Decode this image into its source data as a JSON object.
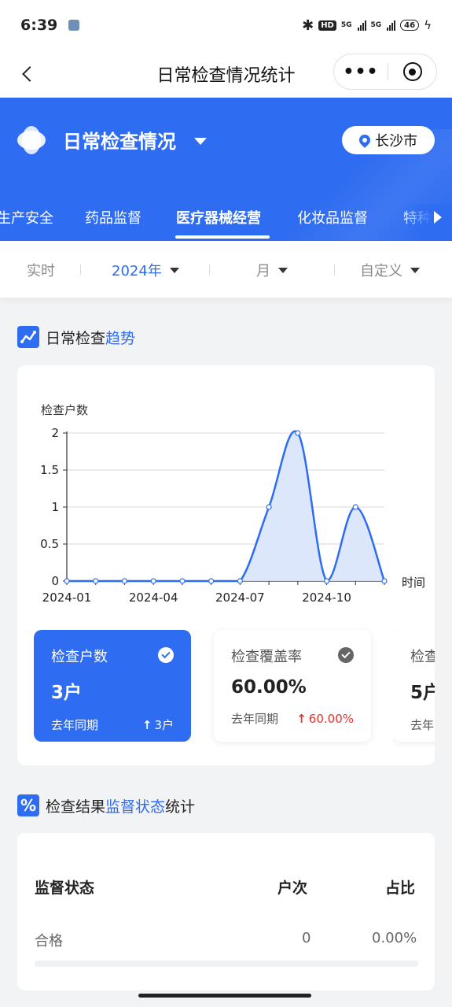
{
  "status_bar": {
    "time": "6:39",
    "hd": "HD",
    "sig1": "5G",
    "sig2": "5G",
    "battery": "46"
  },
  "nav": {
    "title": "日常检查情况统计",
    "more": "•••"
  },
  "header": {
    "title": "日常检查情况",
    "city": "长沙市",
    "tabs": [
      "生产安全",
      "药品监督",
      "医疗器械经营",
      "化妆品监督",
      "特种"
    ],
    "active_tab": "医疗器械经营"
  },
  "filters": {
    "realtime": "实时",
    "year": "2024年",
    "month": "月",
    "custom": "自定义"
  },
  "trend_section": {
    "title_prefix": "日常检查",
    "title_highlight": "趋势"
  },
  "chart_data": {
    "type": "area",
    "ylabel": "检查户数",
    "xlabel": "时间",
    "x": [
      "2024-01",
      "2024-02",
      "2024-03",
      "2024-04",
      "2024-05",
      "2024-06",
      "2024-07",
      "2024-08",
      "2024-09",
      "2024-10",
      "2024-11",
      "2024-12"
    ],
    "xtick_labels": [
      "2024-01",
      "2024-04",
      "2024-07",
      "2024-10"
    ],
    "values": [
      0,
      0,
      0,
      0,
      0,
      0,
      0,
      1,
      2,
      0,
      1,
      0
    ],
    "yticks": [
      "0",
      "0.5",
      "1",
      "1.5",
      "2"
    ],
    "ylim": [
      0,
      2
    ],
    "grid": true,
    "colors": {
      "line": "#2e6cf1",
      "fill": "#d8e4fb"
    }
  },
  "stat_cards": [
    {
      "title": "检查户数",
      "value": "3户",
      "foot_label": "去年同期",
      "delta": "3户",
      "delta_color": "#ffffff"
    },
    {
      "title": "检查覆盖率",
      "value": "60.00%",
      "foot_label": "去年同期",
      "delta": "60.00%",
      "delta_color": "#e5322d"
    },
    {
      "title": "检查",
      "value": "5户",
      "foot_label": "去年",
      "delta": ""
    }
  ],
  "result_section": {
    "title_prefix": "检查结果",
    "title_highlight": "监督状态",
    "title_suffix": "统计"
  },
  "table": {
    "headers": [
      "监督状态",
      "户次",
      "占比"
    ],
    "rows": [
      {
        "status": "合格",
        "count": "0",
        "ratio": "0.00%"
      }
    ]
  },
  "colors": {
    "primary": "#2e6cf1",
    "danger": "#e5322d"
  }
}
